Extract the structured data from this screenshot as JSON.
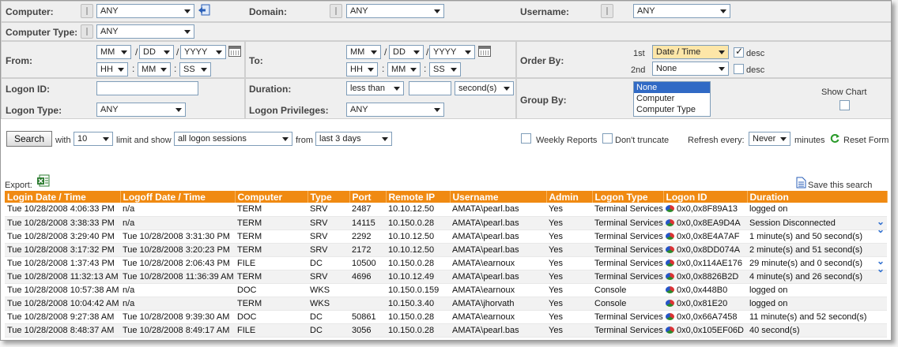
{
  "filters": {
    "computer_label": "Computer:",
    "computer_value": "ANY",
    "domain_label": "Domain:",
    "domain_value": "ANY",
    "username_label": "Username:",
    "username_value": "ANY",
    "computer_type_label": "Computer Type:",
    "computer_type_value": "ANY",
    "from_label": "From:",
    "to_label": "To:",
    "date": {
      "mm": "MM",
      "dd": "DD",
      "yyyy": "YYYY",
      "hh": "HH",
      "min": "MM",
      "ss": "SS",
      "slash": "/",
      "colon": ":"
    },
    "order_by_label": "Order By:",
    "order_1_label": "1st",
    "order_1_value": "Date / Time",
    "order_1_desc": "desc",
    "order_2_label": "2nd",
    "order_2_value": "None",
    "order_2_desc": "desc",
    "logon_id_label": "Logon ID:",
    "logon_id_value": "",
    "logon_type_label": "Logon Type:",
    "logon_type_value": "ANY",
    "duration_label": "Duration:",
    "duration_op": "less than",
    "duration_value": "",
    "duration_unit": "second(s)",
    "logon_priv_label": "Logon Privileges:",
    "logon_priv_value": "ANY",
    "group_by_label": "Group By:",
    "group_by_options": [
      "None",
      "Computer",
      "Computer Type"
    ],
    "show_chart_label": "Show Chart"
  },
  "search_bar": {
    "search_button": "Search",
    "with": "with",
    "limit_value": "10",
    "limit_and_show": "limit and show",
    "show_value": "all logon sessions",
    "from": "from",
    "period_value": "last 3 days",
    "weekly_reports": "Weekly Reports",
    "dont_truncate": "Don't truncate",
    "refresh_label": "Refresh every:",
    "refresh_value": "Never",
    "minutes": "minutes",
    "reset_form": "Reset Form"
  },
  "export_label": "Export:",
  "save_search_label": "Save this search",
  "table": {
    "headers": [
      "Login Date / Time",
      "Logoff Date / Time",
      "Computer",
      "Type",
      "Port",
      "Remote IP",
      "Username",
      "Admin",
      "Logon Type",
      "Logon ID",
      "Duration"
    ],
    "rows": [
      [
        "Tue 10/28/2008 4:06:33 PM",
        "n/a",
        "TERM",
        "SRV",
        "2487",
        "10.10.12.50",
        "AMATA\\pearl.bas",
        "Yes",
        "Terminal Services",
        "0x0,0x8F89A13",
        "logged on"
      ],
      [
        "Tue 10/28/2008 3:38:33 PM",
        "n/a",
        "TERM",
        "SRV",
        "14115",
        "10.150.0.28",
        "AMATA\\pearl.bas",
        "Yes",
        "Terminal Services",
        "0x0,0x8EA9D4A",
        "Session Disconnected"
      ],
      [
        "Tue 10/28/2008 3:29:40 PM",
        "Tue 10/28/2008 3:31:30 PM",
        "TERM",
        "SRV",
        "2292",
        "10.10.12.50",
        "AMATA\\pearl.bas",
        "Yes",
        "Terminal Services",
        "0x0,0x8E4A7AF",
        "1 minute(s) and 50 second(s)"
      ],
      [
        "Tue 10/28/2008 3:17:32 PM",
        "Tue 10/28/2008 3:20:23 PM",
        "TERM",
        "SRV",
        "2172",
        "10.10.12.50",
        "AMATA\\pearl.bas",
        "Yes",
        "Terminal Services",
        "0x0,0x8DD074A",
        "2 minute(s) and 51 second(s)"
      ],
      [
        "Tue 10/28/2008 1:37:43 PM",
        "Tue 10/28/2008 2:06:43 PM",
        "FILE",
        "DC",
        "10500",
        "10.150.0.28",
        "AMATA\\earnoux",
        "Yes",
        "Terminal Services",
        "0x0,0x114AE176",
        "29 minute(s) and 0 second(s)"
      ],
      [
        "Tue 10/28/2008 11:32:13 AM",
        "Tue 10/28/2008 11:36:39 AM",
        "TERM",
        "SRV",
        "4696",
        "10.10.12.49",
        "AMATA\\pearl.bas",
        "Yes",
        "Terminal Services",
        "0x0,0x8826B2D",
        "4 minute(s) and 26 second(s)"
      ],
      [
        "Tue 10/28/2008 10:57:38 AM",
        "n/a",
        "DOC",
        "WKS",
        "",
        "10.150.0.159",
        "AMATA\\earnoux",
        "Yes",
        "Console",
        "0x0,0x448B0",
        "logged on"
      ],
      [
        "Tue 10/28/2008 10:04:42 AM",
        "n/a",
        "TERM",
        "WKS",
        "",
        "10.150.3.40",
        "AMATA\\jhorvath",
        "Yes",
        "Console",
        "0x0,0x81E20",
        "logged on"
      ],
      [
        "Tue 10/28/2008 9:27:38 AM",
        "Tue 10/28/2008 9:39:30 AM",
        "DOC",
        "DC",
        "50861",
        "10.150.0.28",
        "AMATA\\earnoux",
        "Yes",
        "Terminal Services",
        "0x0,0x66A7458",
        "11 minute(s) and 52 second(s)"
      ],
      [
        "Tue 10/28/2008 8:48:37 AM",
        "Tue 10/28/2008 8:49:17 AM",
        "FILE",
        "DC",
        "3056",
        "10.150.0.28",
        "AMATA\\pearl.bas",
        "Yes",
        "Terminal Services",
        "0x0,0x105EF06D",
        "40 second(s)"
      ]
    ]
  },
  "colors": {
    "header_orange": "#f08a12",
    "accent_blue": "#316ac5",
    "refresh_green": "#2a9a2a"
  }
}
